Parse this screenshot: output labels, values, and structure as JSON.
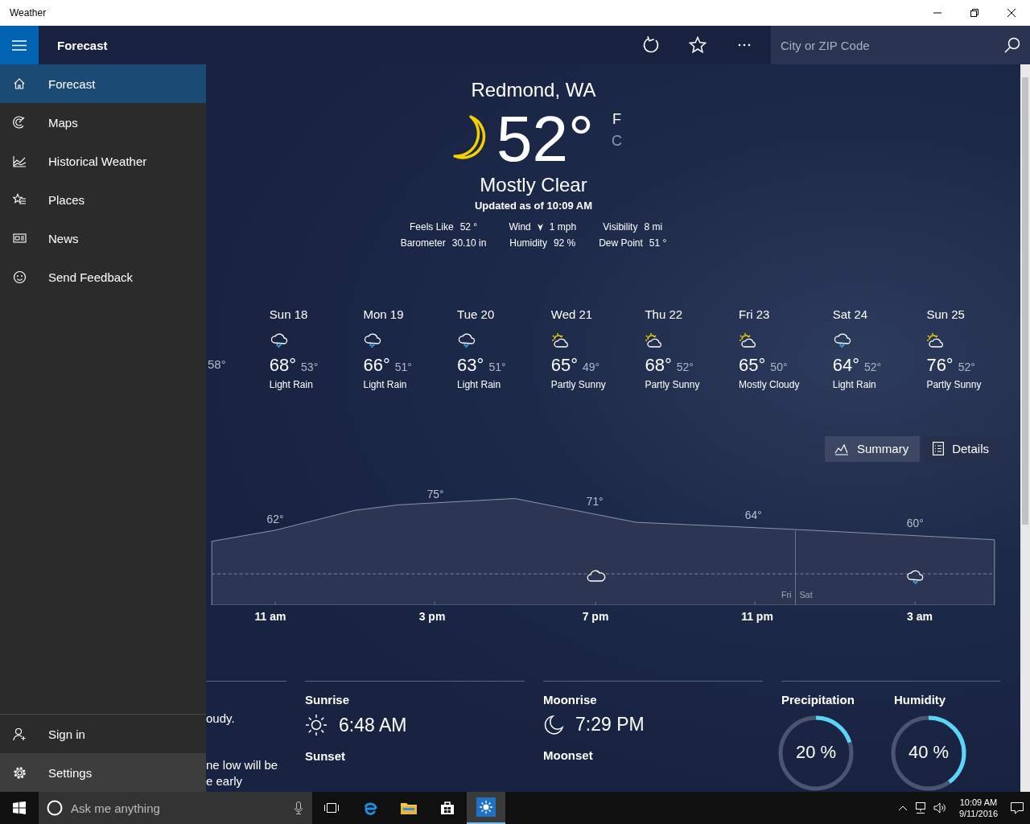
{
  "window": {
    "title": "Weather"
  },
  "app_bar": {
    "title": "Forecast",
    "search": {
      "placeholder": "City or ZIP Code"
    }
  },
  "nav": {
    "items": [
      {
        "label": "Forecast",
        "selected": true
      },
      {
        "label": "Maps",
        "selected": false
      },
      {
        "label": "Historical Weather",
        "selected": false
      },
      {
        "label": "Places",
        "selected": false
      },
      {
        "label": "News",
        "selected": false
      },
      {
        "label": "Send Feedback",
        "selected": false
      }
    ],
    "footer_items": [
      {
        "label": "Sign in",
        "hovered": false
      },
      {
        "label": "Settings",
        "hovered": true
      }
    ]
  },
  "current": {
    "location": "Redmond, WA",
    "temperature": "52°",
    "units": [
      {
        "label": "F",
        "selected": true
      },
      {
        "label": "C",
        "selected": false
      }
    ],
    "condition": "Mostly Clear",
    "updated": "Updated as of 10:09 AM",
    "details": [
      {
        "label": "Feels Like",
        "value": "52 °",
        "kind": "plain"
      },
      {
        "label": "Wind",
        "value": "1 mph",
        "kind": "wind"
      },
      {
        "label": "Visibility",
        "value": "8 mi",
        "kind": "plain"
      },
      {
        "label": "Barometer",
        "value": "30.10 in",
        "kind": "plain"
      },
      {
        "label": "Humidity",
        "value": "92 %",
        "kind": "plain"
      },
      {
        "label": "Dew Point",
        "value": "51 °",
        "kind": "plain"
      }
    ]
  },
  "daily": {
    "partial_low": "58°",
    "days": [
      {
        "day": "Sun 18",
        "kind": "rain",
        "high": "68°",
        "low": "53°",
        "condition": "Light Rain"
      },
      {
        "day": "Mon 19",
        "kind": "rain",
        "high": "66°",
        "low": "51°",
        "condition": "Light Rain"
      },
      {
        "day": "Tue 20",
        "kind": "rain",
        "high": "63°",
        "low": "51°",
        "condition": "Light Rain"
      },
      {
        "day": "Wed 21",
        "kind": "partly_sunny",
        "high": "65°",
        "low": "49°",
        "condition": "Partly Sunny"
      },
      {
        "day": "Thu 22",
        "kind": "partly_sunny",
        "high": "68°",
        "low": "52°",
        "condition": "Partly Sunny"
      },
      {
        "day": "Fri 23",
        "kind": "partly_sunny",
        "high": "65°",
        "low": "50°",
        "condition": "Mostly Cloudy"
      },
      {
        "day": "Sat 24",
        "kind": "rain",
        "high": "64°",
        "low": "52°",
        "condition": "Light Rain"
      },
      {
        "day": "Sun 25",
        "kind": "partly_sunny",
        "high": "76°",
        "low": "52°",
        "condition": "Partly Sunny"
      }
    ]
  },
  "view_toggle": [
    {
      "label": "Summary",
      "selected": true
    },
    {
      "label": "Details",
      "selected": false
    }
  ],
  "hourly": {
    "temps": [
      "62°",
      "75°",
      "71°",
      "64°",
      "60°"
    ],
    "times": [
      "11 am",
      "3 pm",
      "7 pm",
      "11 pm",
      "3 am"
    ],
    "day_marks": [
      "Fri",
      "Sat"
    ]
  },
  "summary_partial": [
    "oudy.",
    "ne low will be",
    "e early"
  ],
  "sun": {
    "rise_label": "Sunrise",
    "rise": "6:48 AM",
    "set_label": "Sunset"
  },
  "moon": {
    "rise_label": "Moonrise",
    "rise": "7:29 PM",
    "set_label": "Moonset"
  },
  "gauges": [
    {
      "label": "Precipitation",
      "value": "20 %",
      "level": 0.2
    },
    {
      "label": "Humidity",
      "value": "40 %",
      "level": 0.4
    }
  ],
  "taskbar": {
    "search": {
      "placeholder": "Ask me anything"
    },
    "apps": [
      {
        "kind": "task_view",
        "active": false
      },
      {
        "kind": "browser",
        "active": false
      },
      {
        "kind": "folder",
        "active": false
      },
      {
        "kind": "store",
        "active": false
      },
      {
        "kind": "weather",
        "active": true
      }
    ],
    "clock": {
      "time": "10:09 AM",
      "date": "9/11/2016"
    }
  }
}
